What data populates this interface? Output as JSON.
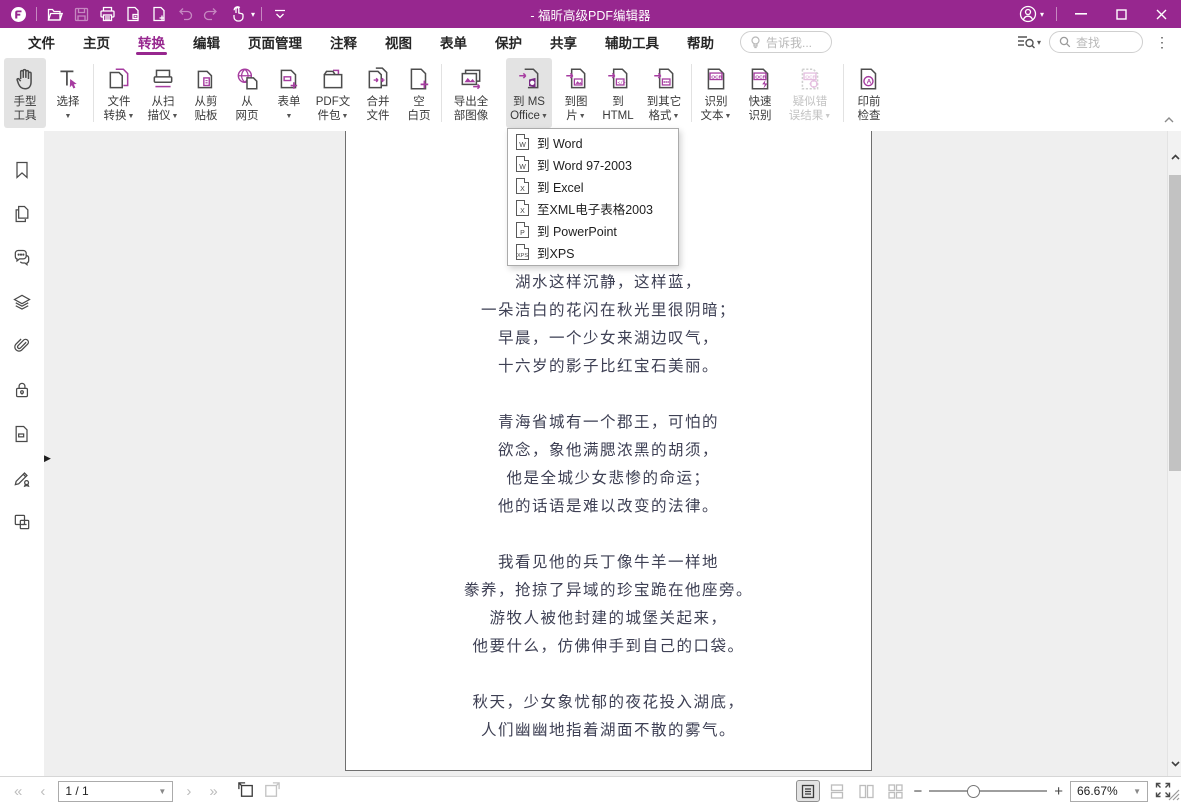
{
  "colors": {
    "brand_purple": "#97278F",
    "icon_accent": "#A63CA0",
    "canvas_gray": "#EFEFEF",
    "ai_blue": "#1E6FE8",
    "active_button_bg": "#E3E3E3"
  },
  "titlebar": {
    "title": "- 福昕高级PDF编辑器",
    "quick_access_icons": [
      "foxit-logo",
      "open-folder",
      "save",
      "print",
      "export-page",
      "new-page",
      "undo",
      "redo",
      "touch-mode",
      "customize-toolbar"
    ]
  },
  "menubar": {
    "tabs": [
      {
        "label": "文件"
      },
      {
        "label": "主页"
      },
      {
        "label": "转换",
        "active": true
      },
      {
        "label": "编辑"
      },
      {
        "label": "页面管理"
      },
      {
        "label": "注释"
      },
      {
        "label": "视图"
      },
      {
        "label": "表单"
      },
      {
        "label": "保护"
      },
      {
        "label": "共享"
      },
      {
        "label": "辅助工具"
      },
      {
        "label": "帮助"
      }
    ],
    "tell_me_placeholder": "告诉我...",
    "find_placeholder": "查找"
  },
  "ribbon": {
    "buttons": [
      {
        "line1": "手型",
        "line2": "工具",
        "active": true
      },
      {
        "line1": "选择",
        "line2": "",
        "dropdown": true
      },
      {
        "line1": "文件",
        "line2": "转换",
        "dropdown": true
      },
      {
        "line1": "从扫",
        "line2": "描仪",
        "dropdown": true
      },
      {
        "line1": "从剪",
        "line2": "贴板"
      },
      {
        "line1": "从",
        "line2": "网页"
      },
      {
        "line1": "表单",
        "line2": "",
        "dropdown": true
      },
      {
        "line1": "PDF文",
        "line2": "件包",
        "dropdown": true
      },
      {
        "line1": "合并",
        "line2": "文件"
      },
      {
        "line1": "空",
        "line2": "白页"
      },
      {
        "line1": "导出全",
        "line2": "部图像"
      },
      {
        "line1": "到 MS",
        "line2": "Office",
        "dropdown": true,
        "active": true
      },
      {
        "line1": "到图",
        "line2": "片",
        "dropdown": true
      },
      {
        "line1": "到",
        "line2": "HTML"
      },
      {
        "line1": "到其它",
        "line2": "格式",
        "dropdown": true
      },
      {
        "line1": "识别",
        "line2": "文本",
        "dropdown": true
      },
      {
        "line1": "快速",
        "line2": "识别"
      },
      {
        "line1": "疑似错",
        "line2": "误结果",
        "dropdown": true,
        "disabled": true
      },
      {
        "line1": "印前",
        "line2": "检查"
      }
    ]
  },
  "office_dropdown": {
    "items": [
      {
        "badge": "W",
        "label": "到 Word"
      },
      {
        "badge": "W",
        "label": "到 Word 97-2003"
      },
      {
        "badge": "X",
        "label": "到 Excel"
      },
      {
        "badge": "X",
        "label": "至XML电子表格2003"
      },
      {
        "badge": "P",
        "label": "到 PowerPoint"
      },
      {
        "badge": "XPS",
        "label": "到XPS"
      }
    ]
  },
  "sidebar": {
    "icons": [
      "bookmark",
      "pages",
      "comments",
      "layers",
      "attachments",
      "security",
      "destinations",
      "signature",
      "fields"
    ]
  },
  "document": {
    "stanzas": [
      [
        "湖水这样沉静，这样蓝，",
        "一朵洁白的花闪在秋光里很阴暗；",
        "早晨，一个少女来湖边叹气，",
        "十六岁的影子比红宝石美丽。"
      ],
      [
        "青海省城有一个郡王，可怕的",
        "欲念，象他满腮浓黑的胡须，",
        "他是全城少女悲惨的命运；",
        "他的话语是难以改变的法律。"
      ],
      [
        "我看见他的兵丁像牛羊一样地",
        "豢养，抢掠了异域的珍宝跪在他座旁。",
        "游牧人被他封建的城堡关起来，",
        "他要什么，仿佛伸手到自己的口袋。"
      ],
      [
        "秋天，少女象忧郁的夜花投入湖底，",
        "人们幽幽地指着湖面不散的雾气。"
      ]
    ]
  },
  "statusbar": {
    "page_indicator": "1 / 1",
    "zoom_value": "66.67%"
  }
}
